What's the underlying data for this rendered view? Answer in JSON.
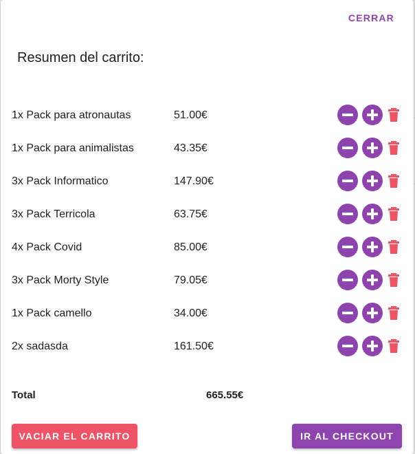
{
  "dialog": {
    "close_label": "CERRAR",
    "title": "Resumen del carrito:"
  },
  "cart": {
    "items": [
      {
        "name": "1x Pack para atronautas",
        "price": "51.00€"
      },
      {
        "name": "1x Pack para animalistas",
        "price": "43.35€"
      },
      {
        "name": "3x Pack Informatico",
        "price": "147.90€"
      },
      {
        "name": "3x Pack Terricola",
        "price": "63.75€"
      },
      {
        "name": "4x Pack Covid",
        "price": "85.00€"
      },
      {
        "name": "3x Pack Morty Style",
        "price": "79.05€"
      },
      {
        "name": "1x Pack camello",
        "price": "34.00€"
      },
      {
        "name": "2x sadasda",
        "price": "161.50€"
      }
    ],
    "item_actions": [
      "minus-icon",
      "plus-icon",
      "trash-icon"
    ]
  },
  "summary": {
    "total_label": "Total",
    "total_value": "665.55€"
  },
  "actions": {
    "empty_cart_label": "VACIAR EL CARRITO",
    "checkout_label": "IR AL CHECKOUT"
  },
  "colors": {
    "primary": "#8e44ad",
    "danger": "#ef5466",
    "icon_fg": "#ffffff"
  }
}
